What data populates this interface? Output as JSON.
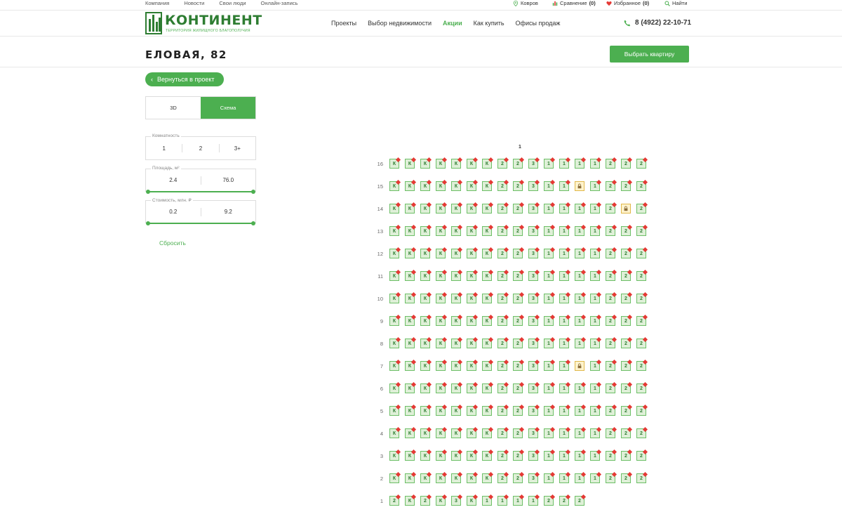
{
  "topbar": {
    "links": [
      "Компания",
      "Новости",
      "Свои люди",
      "Онлайн-запись"
    ],
    "city": "Ковров",
    "compare_label": "Сравнение",
    "compare_count": "(0)",
    "favorites_label": "Избранное",
    "favorites_count": "(0)",
    "search_label": "Найти"
  },
  "header": {
    "logo_text": "КОНТИНЕНТ",
    "logo_sub": "ТЕРРИТОРИЯ ЖИЛИЩНОГО БЛАГОПОЛУЧИЯ",
    "nav": [
      "Проекты",
      "Выбор недвижимости",
      "Акции",
      "Как купить",
      "Офисы продаж"
    ],
    "nav_active_index": 2,
    "phone": "8 (4922) 22-10-71"
  },
  "title": {
    "text": "ЕЛОВАЯ, 82",
    "choose_button": "Выбрать квартиру"
  },
  "panel": {
    "back_button": "Вернуться в проект",
    "view_3d": "3D",
    "view_scheme": "Схема",
    "rooms_label": "Комнатность",
    "rooms_options": [
      "1",
      "2",
      "3+"
    ],
    "area_label": "Площадь, м²",
    "area_min": "2.4",
    "area_max": "76.0",
    "price_label": "Стоимость, млн. ₽",
    "price_min": "0.2",
    "price_max": "9.2",
    "reset": "Сбросить"
  },
  "scheme": {
    "section": "1",
    "floors": [
      {
        "floor": "16",
        "units": [
          "К",
          "К",
          "К",
          "К",
          "К",
          "К",
          "К",
          "2",
          "2",
          "3",
          "1",
          "1",
          "1",
          "1",
          "2",
          "2",
          "2"
        ]
      },
      {
        "floor": "15",
        "units": [
          "К",
          "К",
          "К",
          "К",
          "К",
          "К",
          "К",
          "2",
          "2",
          "3",
          "1",
          "1",
          "L",
          "1",
          "2",
          "2",
          "2"
        ]
      },
      {
        "floor": "14",
        "units": [
          "К",
          "К",
          "К",
          "К",
          "К",
          "К",
          "К",
          "2",
          "2",
          "3",
          "1",
          "1",
          "1",
          "1",
          "2",
          "L",
          "2"
        ]
      },
      {
        "floor": "13",
        "units": [
          "К",
          "К",
          "К",
          "К",
          "К",
          "К",
          "К",
          "2",
          "2",
          "3",
          "1",
          "1",
          "1",
          "1",
          "2",
          "2",
          "2"
        ]
      },
      {
        "floor": "12",
        "units": [
          "К",
          "К",
          "К",
          "К",
          "К",
          "К",
          "К",
          "2",
          "2",
          "3",
          "1",
          "1",
          "1",
          "1",
          "2",
          "2",
          "2"
        ]
      },
      {
        "floor": "11",
        "units": [
          "К",
          "К",
          "К",
          "К",
          "К",
          "К",
          "К",
          "2",
          "2",
          "3",
          "1",
          "1",
          "1",
          "1",
          "2",
          "2",
          "2"
        ]
      },
      {
        "floor": "10",
        "units": [
          "К",
          "К",
          "К",
          "К",
          "К",
          "К",
          "К",
          "2",
          "2",
          "3",
          "1",
          "1",
          "1",
          "1",
          "2",
          "2",
          "2"
        ]
      },
      {
        "floor": "9",
        "units": [
          "К",
          "К",
          "К",
          "К",
          "К",
          "К",
          "К",
          "2",
          "2",
          "3",
          "1",
          "1",
          "1",
          "1",
          "2",
          "2",
          "2"
        ]
      },
      {
        "floor": "8",
        "units": [
          "К",
          "К",
          "К",
          "К",
          "К",
          "К",
          "К",
          "2",
          "2",
          "3",
          "1",
          "1",
          "1",
          "1",
          "2",
          "2",
          "2"
        ]
      },
      {
        "floor": "7",
        "units": [
          "К",
          "К",
          "К",
          "К",
          "К",
          "К",
          "К",
          "2",
          "2",
          "3",
          "1",
          "1",
          "L",
          "1",
          "2",
          "2",
          "2"
        ]
      },
      {
        "floor": "6",
        "units": [
          "К",
          "К",
          "К",
          "К",
          "К",
          "К",
          "К",
          "2",
          "2",
          "3",
          "1",
          "1",
          "1",
          "1",
          "2",
          "2",
          "2"
        ]
      },
      {
        "floor": "5",
        "units": [
          "К",
          "К",
          "К",
          "К",
          "К",
          "К",
          "К",
          "2",
          "2",
          "3",
          "1",
          "1",
          "1",
          "1",
          "2",
          "2",
          "2"
        ]
      },
      {
        "floor": "4",
        "units": [
          "К",
          "К",
          "К",
          "К",
          "К",
          "К",
          "К",
          "2",
          "2",
          "3",
          "1",
          "1",
          "1",
          "1",
          "2",
          "2",
          "2"
        ]
      },
      {
        "floor": "3",
        "units": [
          "К",
          "К",
          "К",
          "К",
          "К",
          "К",
          "К",
          "2",
          "2",
          "3",
          "1",
          "1",
          "1",
          "1",
          "2",
          "2",
          "2"
        ]
      },
      {
        "floor": "2",
        "units": [
          "К",
          "К",
          "К",
          "К",
          "К",
          "К",
          "К",
          "2",
          "2",
          "3",
          "1",
          "1",
          "1",
          "1",
          "2",
          "2",
          "2"
        ]
      },
      {
        "floor": "1",
        "units": [
          "2",
          "К",
          "2",
          "К",
          "3",
          "К",
          "1",
          "1",
          "1",
          "1",
          "2",
          "2",
          "2"
        ]
      }
    ]
  }
}
